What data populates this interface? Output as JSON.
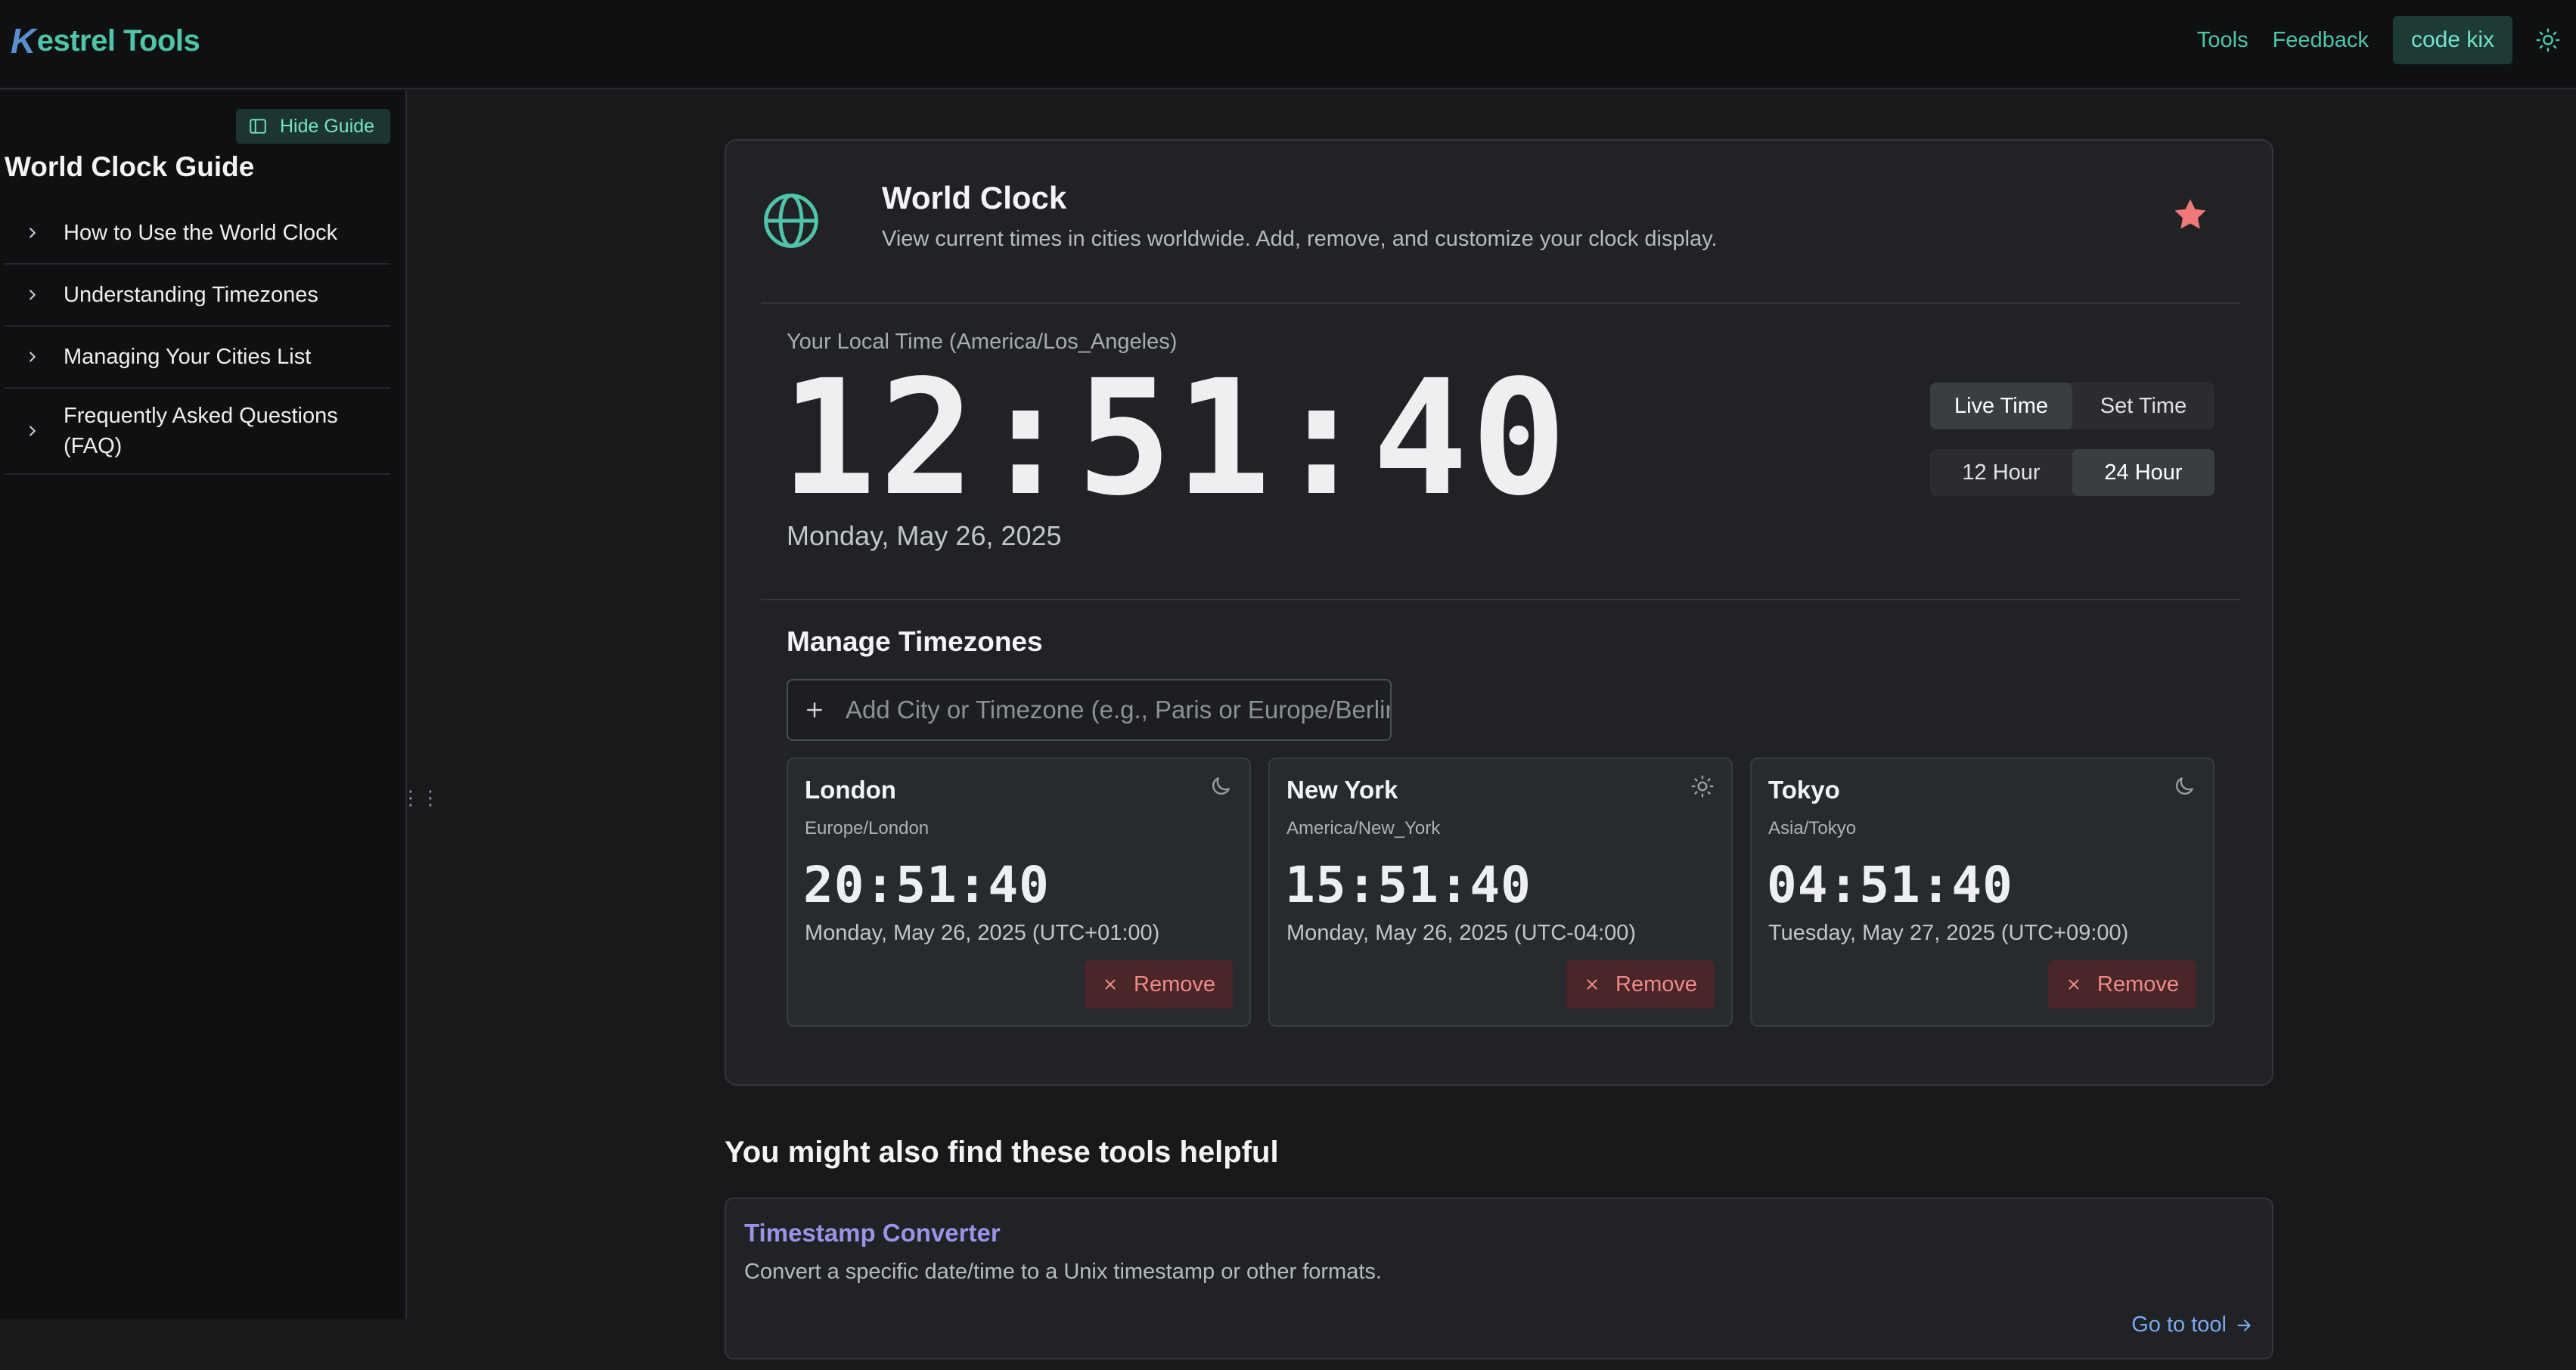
{
  "header": {
    "brand_initial": "K",
    "brand_rest": "estrel Tools",
    "nav_tools": "Tools",
    "nav_feedback": "Feedback",
    "user_button": "code kix",
    "theme_icon": "sun-icon"
  },
  "sidebar": {
    "hide_guide": "Hide Guide",
    "title": "World Clock Guide",
    "items": [
      {
        "label": "How to Use the World Clock"
      },
      {
        "label": "Understanding Timezones"
      },
      {
        "label": "Managing Your Cities List"
      },
      {
        "label": "Frequently Asked Questions (FAQ)"
      }
    ]
  },
  "tool": {
    "title": "World Clock",
    "description": "View current times in cities worldwide. Add, remove, and customize your clock display.",
    "local_label": "Your Local Time (America/Los_Angeles)",
    "local_time": "12:51:40",
    "local_date": "Monday, May 26, 2025",
    "mode_options": {
      "live": "Live Time",
      "set": "Set Time",
      "selected": "Live Time"
    },
    "format_options": {
      "h12": "12 Hour",
      "h24": "24 Hour",
      "selected": "24 Hour"
    },
    "manage_title": "Manage Timezones",
    "add_placeholder": "Add City or Timezone (e.g., Paris or Europe/Berlin)",
    "remove_label": "Remove",
    "cities": [
      {
        "name": "London",
        "tz": "Europe/London",
        "time": "20:51:40",
        "date": "Monday, May 26, 2025 (UTC+01:00)",
        "icon": "moon-icon"
      },
      {
        "name": "New York",
        "tz": "America/New_York",
        "time": "15:51:40",
        "date": "Monday, May 26, 2025 (UTC-04:00)",
        "icon": "sun-icon"
      },
      {
        "name": "Tokyo",
        "tz": "Asia/Tokyo",
        "time": "04:51:40",
        "date": "Tuesday, May 27, 2025 (UTC+09:00)",
        "icon": "moon-icon"
      }
    ]
  },
  "related": {
    "title": "You might also find these tools helpful",
    "items": [
      {
        "name": "Timestamp Converter",
        "description": "Convert a specific date/time to a Unix timestamp or other formats.",
        "link": "Go to tool"
      }
    ]
  },
  "colors": {
    "accent": "#4fc4a8",
    "star": "#f07878",
    "remove_text": "#f08a8a",
    "related_link": "#79a8ef"
  }
}
